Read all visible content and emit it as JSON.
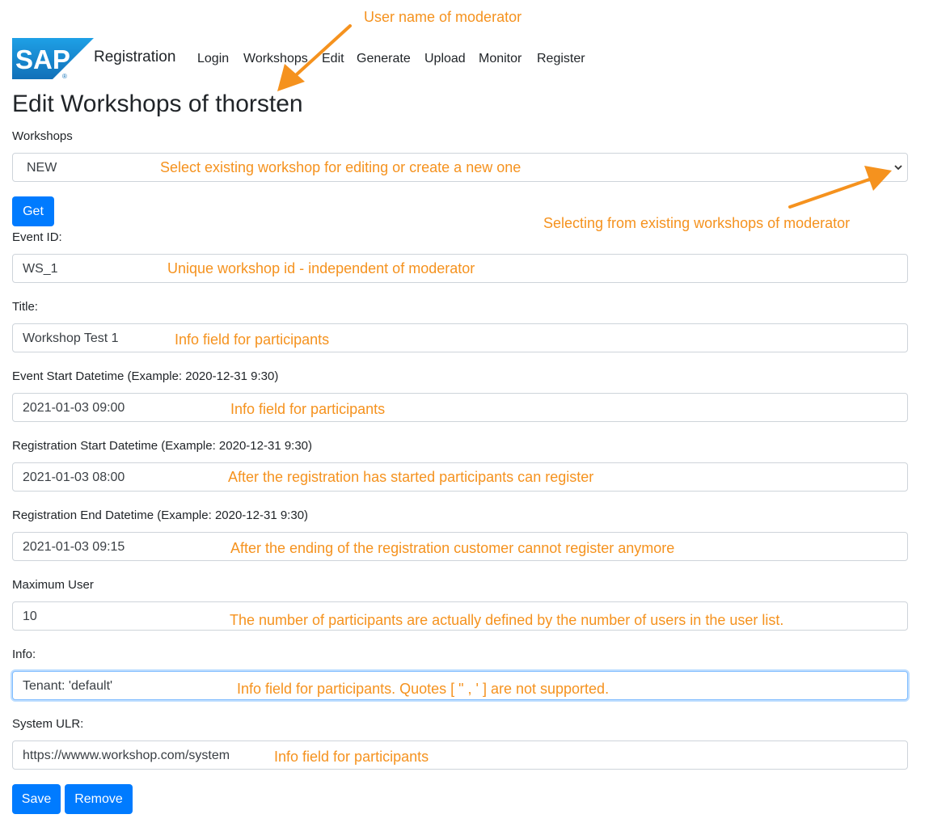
{
  "navbar": {
    "logo_text": "SAP",
    "brand": "Registration",
    "links": [
      "Login",
      "Workshops",
      "Edit",
      "Generate",
      "Upload",
      "Monitor",
      "Register"
    ]
  },
  "page_title": "Edit Workshops of thorsten",
  "form": {
    "workshops": {
      "label": "Workshops",
      "value": "NEW"
    },
    "get_label": "Get",
    "event_id": {
      "label": "Event ID:",
      "value": "WS_1"
    },
    "title": {
      "label": "Title:",
      "value": "Workshop Test 1"
    },
    "event_start": {
      "label": "Event Start Datetime (Example: 2020-12-31 9:30)",
      "value": "2021-01-03 09:00"
    },
    "reg_start": {
      "label": "Registration Start Datetime (Example: 2020-12-31 9:30)",
      "value": "2021-01-03 08:00"
    },
    "reg_end": {
      "label": "Registration End Datetime (Example: 2020-12-31 9:30)",
      "value": "2021-01-03 09:15"
    },
    "max_user": {
      "label": "Maximum User",
      "value": "10"
    },
    "info": {
      "label": "Info:",
      "value": "Tenant: 'default'"
    },
    "system_url": {
      "label": "System ULR:",
      "value": "https://wwww.workshop.com/system"
    },
    "save_label": "Save",
    "remove_label": "Remove"
  },
  "annotations": {
    "moderator": "User name of moderator",
    "select": "Select existing workshop for editing or create a new one",
    "selecting": "Selecting from existing workshops of moderator",
    "event_id": "Unique workshop id - independent of moderator",
    "title": "Info field for participants",
    "event_start": "Info field for participants",
    "reg_start": "After the registration has started participants can register",
    "reg_end": "After the ending of the registration customer cannot register anymore",
    "max_user": "The number of participants are actually defined by the number of users in the user list.",
    "info": "Info field for participants. Quotes [ \" , ' ] are not supported.",
    "system_url": "Info field for participants"
  },
  "colors": {
    "primary": "#007bff",
    "annotation": "#f5921e",
    "logo_blue": "#1f8fd6",
    "text": "#212529"
  }
}
